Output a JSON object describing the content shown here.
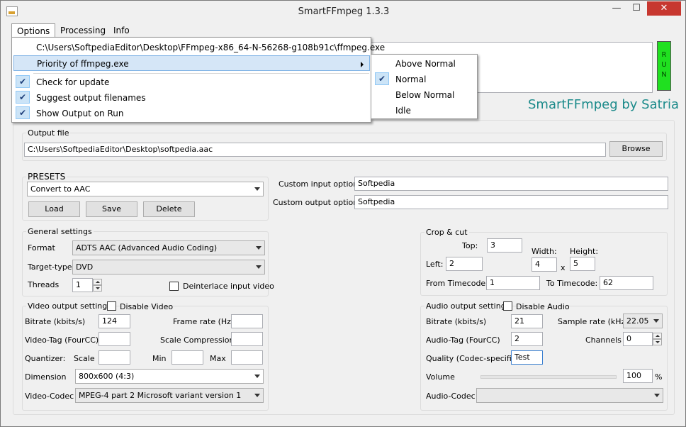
{
  "window": {
    "title": "SmartFFmpeg 1.3.3",
    "minimize": "—",
    "maximize": "☐",
    "close": "✕"
  },
  "menu": {
    "options": "Options",
    "processing": "Processing",
    "info": "Info"
  },
  "options_menu": {
    "path_item": "C:\\Users\\SoftpediaEditor\\Desktop\\FFmpeg-x86_64-N-56268-g108b91c\\ffmpeg.exe",
    "priority": "Priority of ffmpeg.exe",
    "check_update": "Check for update",
    "suggest_names": "Suggest output filenames",
    "show_output": "Show Output on Run"
  },
  "priority_menu": {
    "above_normal": "Above Normal",
    "normal": "Normal",
    "below_normal": "Below Normal",
    "idle": "Idle"
  },
  "run_button": [
    "R",
    "U",
    "N"
  ],
  "brand": "SmartFFmpeg by Satria",
  "output": {
    "legend": "Output file",
    "path": "C:\\Users\\SoftpediaEditor\\Desktop\\softpedia.aac",
    "browse": "Browse"
  },
  "presets": {
    "legend": "PRESETS",
    "selected": "Convert to AAC",
    "load": "Load",
    "save": "Save",
    "delete": "Delete"
  },
  "custom": {
    "input_label": "Custom input options:",
    "input_value": "Softpedia",
    "output_label": "Custom output options:",
    "output_value": "Softpedia"
  },
  "general": {
    "legend": "General settings",
    "format_label": "Format",
    "format_value": "ADTS AAC (Advanced Audio Coding)",
    "target_label": "Target-type",
    "target_value": "DVD",
    "threads_label": "Threads",
    "threads_value": "1",
    "deinterlace": "Deinterlace input video"
  },
  "crop": {
    "legend": "Crop & cut",
    "top_label": "Top:",
    "top": "3",
    "left_label": "Left:",
    "left": "2",
    "width_label": "Width:",
    "width": "4",
    "x": "x",
    "height_label": "Height:",
    "height": "5",
    "from_label": "From Timecode:",
    "from": "1",
    "to_label": "To Timecode:",
    "to": "62"
  },
  "video": {
    "legend": "Video output settings",
    "disable": "Disable Video",
    "bitrate_label": "Bitrate (kbits/s)",
    "bitrate": "124",
    "framerate_label": "Frame rate (Hz)",
    "framerate": "",
    "tag_label": "Video-Tag (FourCC)",
    "tag": "",
    "scale_comp_label": "Scale Compression",
    "scale_comp": "",
    "quantizer_label": "Quantizer:",
    "scale_label": "Scale",
    "scale": "",
    "min_label": "Min",
    "min": "",
    "max_label": "Max",
    "max": "",
    "dimension_label": "Dimension",
    "dimension": "800x600 (4:3)",
    "codec_label": "Video-Codec",
    "codec": "MPEG-4 part 2 Microsoft variant version 1"
  },
  "audio": {
    "legend": "Audio output settings",
    "disable": "Disable Audio",
    "bitrate_label": "Bitrate (kbits/s)",
    "bitrate": "21",
    "sample_label": "Sample rate (kHz)",
    "sample": "22.05",
    "tag_label": "Audio-Tag (FourCC)",
    "tag": "2",
    "channels_label": "Channels",
    "channels": "0",
    "quality_label": "Quality (Codec-specific)",
    "quality": "Test",
    "volume_label": "Volume",
    "volume": "100",
    "volume_unit": "%",
    "codec_label": "Audio-Codec",
    "codec": ""
  },
  "colors": {
    "run": "#20e020",
    "brand": "#1b8a8a",
    "close": "#c7372f"
  }
}
